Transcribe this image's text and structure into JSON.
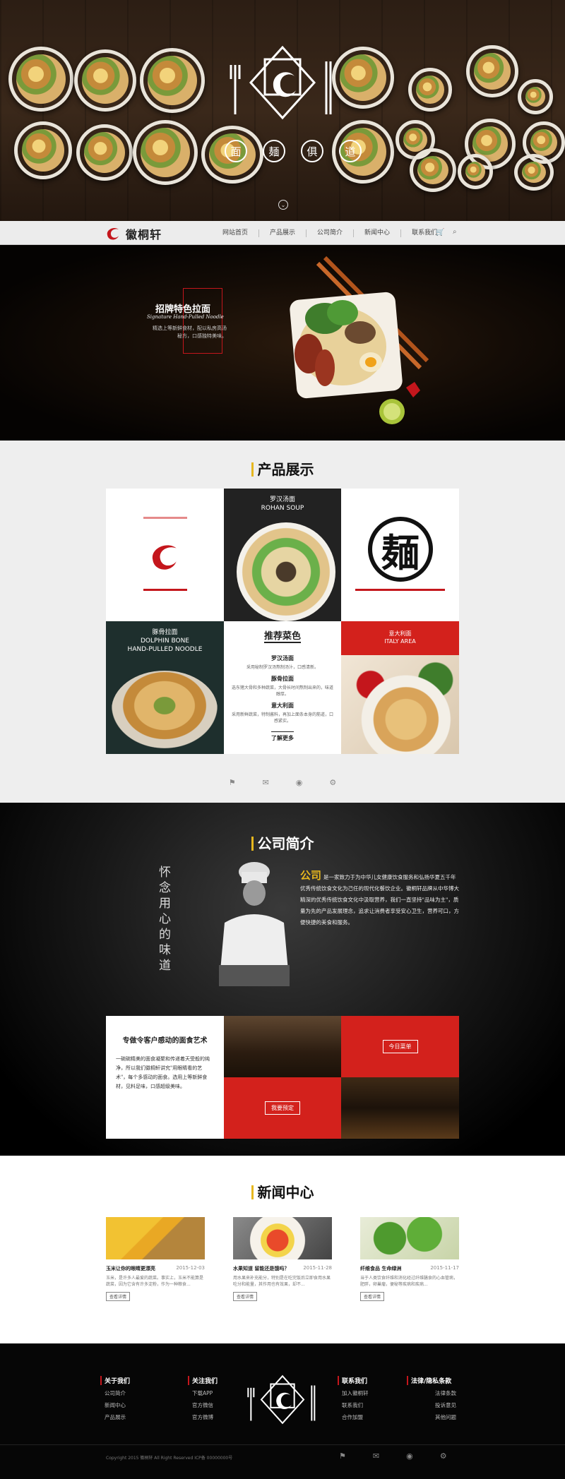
{
  "hero": {
    "chars": [
      "面",
      "麺",
      "俱",
      "道"
    ],
    "scroll_icon": "chevron-down-icon"
  },
  "nav": {
    "brand": "徽桐轩",
    "items": [
      "网站首页",
      "产品展示",
      "公司简介",
      "新闻中心",
      "联系我们"
    ],
    "cart_icon": "🛒",
    "search_icon": "⌕"
  },
  "signature": {
    "title": "招牌特色拉面",
    "subtitle": "Signature Hand-Pulled Noodle",
    "desc": "精选上等新鲜食材，配以私房高汤秘方，口感独特美味。"
  },
  "products": {
    "title": "产品展示",
    "items": {
      "rohan": {
        "name": "罗汉汤面",
        "en": "ROHAN SOUP"
      },
      "dolphin": {
        "name": "豚骨拉面",
        "en1": "DOLPHIN BONE",
        "en2": "HAND-PULLED NOODLE"
      },
      "italy": {
        "name": "意大利面",
        "en": "ITALY AREA"
      }
    },
    "recommend": {
      "title": "推荐菜色",
      "entries": [
        {
          "name": "罗汉汤面",
          "text": "采用秘制罗汉汤熬制汤汁，口感清新。"
        },
        {
          "name": "豚骨拉面",
          "text": "选东猪大骨和多种蔬菜，大骨长时间熬制出来的，味道醇厚。"
        },
        {
          "name": "意大利面",
          "text": "采用新鲜蔬菜，特制酱料，再加上面条本身的筋道，口感紧实。"
        }
      ],
      "more": "了解更多"
    },
    "stamp": "麺",
    "icons": [
      "⚑",
      "✉",
      "◉",
      "⚙"
    ]
  },
  "company": {
    "title": "公司简介",
    "vertical": "怀念用心的味道",
    "intro_big": "公司",
    "intro": "是一家致力于为中华儿女健康饮食服务和弘扬华夏五千年优秀传统饮食文化为己任的现代化餐饮企业。徽桐轩品牌从中华博大精深的优秀传统饮食文化中汲取营养，我们一直坚持\"品味为主\"，质量为先的产品发展理念，追求让消费者享受安心卫生，营养可口，方便快捷的美食和服务。",
    "article_title": "专做令客户感动的面食艺术",
    "article_text": "一碗碗精美的面食凝聚和传递着天受般的纯净，所以我们徽桐轩讲究\"用眼睛看的艺术\"，每个多感动的面食。选用上等新鲜食材，见料足味，口感超级美味。",
    "menu_btn": "今日菜单",
    "reserve_btn": "我要预定"
  },
  "news": {
    "title": "新闻中心",
    "items": [
      {
        "title": "玉米让你的眼睛更漂亮",
        "date": "2015-12-03",
        "summary": "玉米，是许多人最爱的蔬菜。事实上，玉米不能算是蔬菜，因为它含有许多淀粉，作为一种粮食...",
        "btn": "查看详情"
      },
      {
        "title": "水果知道 留能还是饿吗？",
        "date": "2015-11-28",
        "summary": "用水果来补充能分，特别是在吃完饭后立即食用水果吃分和能量，其作用也有效果，却不...",
        "btn": "查看详情"
      },
      {
        "title": "纤维食品 生命绿洲",
        "date": "2015-11-17",
        "summary": "当于人类饮食纤维和消化经过纤维膳食的心血管病，肥胖，卵巢瘤，便秘等疾病和疾病...",
        "btn": "查看详情"
      }
    ]
  },
  "footer": {
    "cols": [
      {
        "head": "关于我们",
        "links": [
          "公司简介",
          "新闻中心",
          "产品展示"
        ]
      },
      {
        "head": "关注我们",
        "links": [
          "下载APP",
          "官方微信",
          "官方微博"
        ]
      },
      {
        "head": "联系我们",
        "links": [
          "加入徽桐轩",
          "联系我们",
          "合作加盟"
        ]
      },
      {
        "head": "法律/隐私条款",
        "links": [
          "法律条款",
          "投诉意见",
          "其他问题"
        ]
      }
    ],
    "copyright": "Copyright 2015 徽桐轩 All Right Reserved ICP备 00000000号",
    "icons": [
      "⚑",
      "✉",
      "◉",
      "⚙"
    ]
  }
}
